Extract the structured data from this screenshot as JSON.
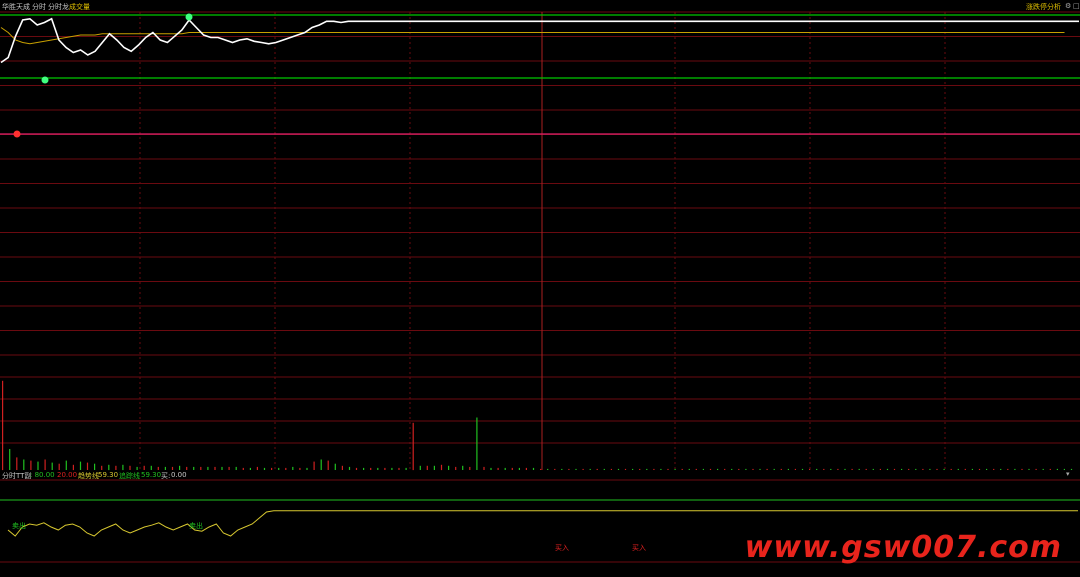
{
  "header": {
    "stock_name": "华胜天成",
    "tab_intraday": "分时",
    "tab_intraday_dragon": "分时龙",
    "tab_volume": "成交量",
    "right_link": "涨跌停分析"
  },
  "sub_panel": {
    "title": "分时TT副",
    "val1": ": 80.00",
    "val2": "20.00",
    "trend_label": "趋势线",
    "trend_value": "59.30",
    "tracking_label": "追踪线",
    "tracking_value": "59.30",
    "buy_label": "买:",
    "buy_value": "0.00",
    "signal_sell": "卖出",
    "signal_buy": "买入"
  },
  "watermark": "www.gsw007.com",
  "colors": {
    "price": "#ffffff",
    "avg": "#c8a000",
    "limit_up": "#00c800",
    "support": "#e0206a",
    "grid": "#6a0a10",
    "vol_up": "#d02020",
    "vol_down": "#20c020",
    "trend": "#d8c830",
    "tracking": "#20c020"
  },
  "chart_data": [
    {
      "type": "line",
      "series": [
        {
          "values": [
            0.62,
            0.66,
            0.83,
            0.96,
            0.97,
            0.92,
            0.94,
            0.97,
            0.8,
            0.74,
            0.7,
            0.72,
            0.68,
            0.71,
            0.78,
            0.85,
            0.8,
            0.74,
            0.71,
            0.76,
            0.82,
            0.86,
            0.8,
            0.78,
            0.83,
            0.88,
            0.96,
            0.9,
            0.84,
            0.82,
            0.82,
            0.8,
            0.78,
            0.8,
            0.81,
            0.79,
            0.78,
            0.77,
            0.78,
            0.8,
            0.82,
            0.84,
            0.86,
            0.9,
            0.92,
            0.95,
            0.95,
            0.94,
            0.95,
            0.95,
            0.95,
            0.95,
            0.95,
            0.95,
            0.95,
            0.95,
            0.95,
            0.95,
            0.95,
            0.95,
            0.95,
            0.95,
            0.95,
            0.95,
            0.95,
            0.95,
            0.95,
            0.95,
            0.95,
            0.95,
            0.95,
            0.95,
            0.95,
            0.95,
            0.95,
            0.95,
            0.95,
            0.95,
            0.95,
            0.95,
            0.95,
            0.95,
            0.95,
            0.95,
            0.95,
            0.95,
            0.95,
            0.95,
            0.95,
            0.95,
            0.95,
            0.95,
            0.95,
            0.95,
            0.95,
            0.95,
            0.95,
            0.95,
            0.95,
            0.95,
            0.95,
            0.95,
            0.95,
            0.95,
            0.95,
            0.95,
            0.95,
            0.95,
            0.95,
            0.95,
            0.95,
            0.95,
            0.95,
            0.95,
            0.95,
            0.95,
            0.95,
            0.95,
            0.95,
            0.95,
            0.95,
            0.95,
            0.95,
            0.95,
            0.95,
            0.95,
            0.95,
            0.95,
            0.95,
            0.95,
            0.95,
            0.95,
            0.95,
            0.95,
            0.95,
            0.95,
            0.95,
            0.95,
            0.95,
            0.95,
            0.95,
            0.95,
            0.95,
            0.95,
            0.95,
            0.95,
            0.95,
            0.95,
            0.95,
            0.95
          ]
        },
        {
          "values": [
            0.9,
            0.86,
            0.8,
            0.78,
            0.77,
            0.78,
            0.79,
            0.8,
            0.81,
            0.82,
            0.83,
            0.84,
            0.84,
            0.84,
            0.85,
            0.85,
            0.85,
            0.85,
            0.85,
            0.85,
            0.85,
            0.85,
            0.85,
            0.85,
            0.85,
            0.85,
            0.86,
            0.86,
            0.86,
            0.86,
            0.86,
            0.86,
            0.86,
            0.86,
            0.86,
            0.86,
            0.86,
            0.86,
            0.86,
            0.86,
            0.86,
            0.86,
            0.86,
            0.86,
            0.86,
            0.86,
            0.86,
            0.86,
            0.86,
            0.86,
            0.86,
            0.86,
            0.86,
            0.86,
            0.86,
            0.86,
            0.86,
            0.86,
            0.86,
            0.86,
            0.86,
            0.86,
            0.86,
            0.86,
            0.86,
            0.86,
            0.86,
            0.86,
            0.86,
            0.86,
            0.86,
            0.86,
            0.86,
            0.86,
            0.86,
            0.86,
            0.86,
            0.86,
            0.86,
            0.86,
            0.86,
            0.86,
            0.86,
            0.86,
            0.86,
            0.86,
            0.86,
            0.86,
            0.86,
            0.86,
            0.86,
            0.86,
            0.86,
            0.86,
            0.86,
            0.86,
            0.86,
            0.86,
            0.86,
            0.86,
            0.86,
            0.86,
            0.86,
            0.86,
            0.86,
            0.86,
            0.86,
            0.86,
            0.86,
            0.86,
            0.86,
            0.86,
            0.86,
            0.86,
            0.86,
            0.86,
            0.86,
            0.86,
            0.86,
            0.86,
            0.86,
            0.86,
            0.86,
            0.86,
            0.86,
            0.86,
            0.86,
            0.86,
            0.86,
            0.86,
            0.86,
            0.86,
            0.86,
            0.86,
            0.86,
            0.86,
            0.86,
            0.86,
            0.86,
            0.86,
            0.86,
            0.86,
            0.86,
            0.86,
            0.86,
            0.86,
            0.86,
            0.86
          ]
        }
      ]
    },
    {
      "type": "bar",
      "values": [
        0.85,
        0.2,
        0.12,
        0.1,
        0.09,
        0.08,
        0.1,
        0.07,
        0.06,
        0.09,
        0.05,
        0.08,
        0.07,
        0.06,
        0.04,
        0.05,
        0.04,
        0.05,
        0.04,
        0.03,
        0.04,
        0.04,
        0.03,
        0.03,
        0.03,
        0.04,
        0.03,
        0.03,
        0.03,
        0.03,
        0.03,
        0.03,
        0.03,
        0.03,
        0.02,
        0.02,
        0.03,
        0.02,
        0.02,
        0.02,
        0.02,
        0.03,
        0.02,
        0.02,
        0.08,
        0.1,
        0.09,
        0.06,
        0.04,
        0.03,
        0.02,
        0.02,
        0.02,
        0.02,
        0.02,
        0.02,
        0.02,
        0.02,
        0.45,
        0.04,
        0.04,
        0.04,
        0.05,
        0.04,
        0.03,
        0.04,
        0.03,
        0.5,
        0.03,
        0.02,
        0.02,
        0.02,
        0.02,
        0.02,
        0.02,
        0.02,
        0.01,
        0.01,
        0.01,
        0.01,
        0.01,
        0.01,
        0.01,
        0.01,
        0.01,
        0.01,
        0.01,
        0.01,
        0.01,
        0.01,
        0.01,
        0.01,
        0.01,
        0.01,
        0.01,
        0.01,
        0.01,
        0.01,
        0.01,
        0.01,
        0.01,
        0.01,
        0.01,
        0.01,
        0.01,
        0.01,
        0.01,
        0.01,
        0.01,
        0.01,
        0.01,
        0.01,
        0.01,
        0.01,
        0.01,
        0.01,
        0.01,
        0.01,
        0.01,
        0.01,
        0.01,
        0.01,
        0.01,
        0.01,
        0.01,
        0.01,
        0.01,
        0.01,
        0.01,
        0.01,
        0.01,
        0.01,
        0.01,
        0.01,
        0.01,
        0.01,
        0.01,
        0.01,
        0.01,
        0.01,
        0.01,
        0.01,
        0.01,
        0.01,
        0.01,
        0.01,
        0.01,
        0.01,
        0.01,
        0.01,
        0.01,
        0.01
      ],
      "up_flags": [
        1,
        0,
        1,
        0,
        1,
        0,
        1,
        0,
        1,
        0,
        1,
        0,
        1,
        0,
        1,
        0,
        1,
        0,
        1,
        0,
        1,
        0,
        1,
        0,
        1,
        0,
        1,
        0,
        1,
        0,
        1,
        0,
        1,
        0,
        1,
        0,
        1,
        0,
        1,
        0,
        1,
        0,
        1,
        0,
        1,
        0,
        1,
        0,
        1,
        0,
        1,
        0,
        1,
        0,
        1,
        0,
        1,
        0,
        1,
        0,
        1,
        0,
        1,
        0,
        1,
        0,
        1,
        0,
        1,
        0,
        1,
        0,
        1,
        0,
        1,
        0,
        1,
        0,
        1,
        0,
        1,
        0,
        1,
        0,
        1,
        0,
        1,
        0,
        1,
        0,
        1,
        0,
        1,
        0,
        1,
        0,
        1,
        0,
        1,
        0,
        1,
        0,
        1,
        0,
        1,
        0,
        1,
        0,
        1,
        0,
        1,
        0,
        1,
        0,
        1,
        0,
        1,
        0,
        1,
        0,
        1,
        0,
        1,
        0,
        1,
        0,
        1,
        0,
        1,
        0,
        1,
        0,
        1,
        0,
        1,
        0,
        1,
        0,
        1,
        0,
        1,
        0,
        1,
        0,
        1,
        0,
        1,
        0,
        1,
        0
      ]
    },
    {
      "type": "line",
      "series": [
        {
          "values": [
            0.5,
            0.4,
            0.55,
            0.6,
            0.58,
            0.62,
            0.55,
            0.5,
            0.58,
            0.6,
            0.55,
            0.45,
            0.4,
            0.5,
            0.55,
            0.6,
            0.5,
            0.45,
            0.5,
            0.55,
            0.58,
            0.62,
            0.55,
            0.5,
            0.55,
            0.6,
            0.5,
            0.48,
            0.55,
            0.6,
            0.45,
            0.4,
            0.5,
            0.55,
            0.6,
            0.7,
            0.8,
            0.82,
            0.82,
            0.82,
            0.82,
            0.82,
            0.82,
            0.82,
            0.82,
            0.82,
            0.82,
            0.82,
            0.82,
            0.82,
            0.82,
            0.82,
            0.82,
            0.82,
            0.82,
            0.82,
            0.82,
            0.82,
            0.82,
            0.82,
            0.82,
            0.82,
            0.82,
            0.82,
            0.82,
            0.82,
            0.82,
            0.82,
            0.82,
            0.82,
            0.82,
            0.82,
            0.82,
            0.82,
            0.82,
            0.82,
            0.82,
            0.82,
            0.82,
            0.82,
            0.82,
            0.82,
            0.82,
            0.82,
            0.82,
            0.82,
            0.82,
            0.82,
            0.82,
            0.82,
            0.82,
            0.82,
            0.82,
            0.82,
            0.82,
            0.82,
            0.82,
            0.82,
            0.82,
            0.82,
            0.82,
            0.82,
            0.82,
            0.82,
            0.82,
            0.82,
            0.82,
            0.82,
            0.82,
            0.82,
            0.82,
            0.82,
            0.82,
            0.82,
            0.82,
            0.82,
            0.82,
            0.82,
            0.82,
            0.82,
            0.82,
            0.82,
            0.82,
            0.82,
            0.82,
            0.82,
            0.82,
            0.82,
            0.82,
            0.82,
            0.82,
            0.82,
            0.82,
            0.82,
            0.82,
            0.82,
            0.82,
            0.82,
            0.82,
            0.82,
            0.82,
            0.82,
            0.82,
            0.82,
            0.82,
            0.82,
            0.82,
            0.82,
            0.82,
            0.82
          ]
        }
      ]
    }
  ]
}
